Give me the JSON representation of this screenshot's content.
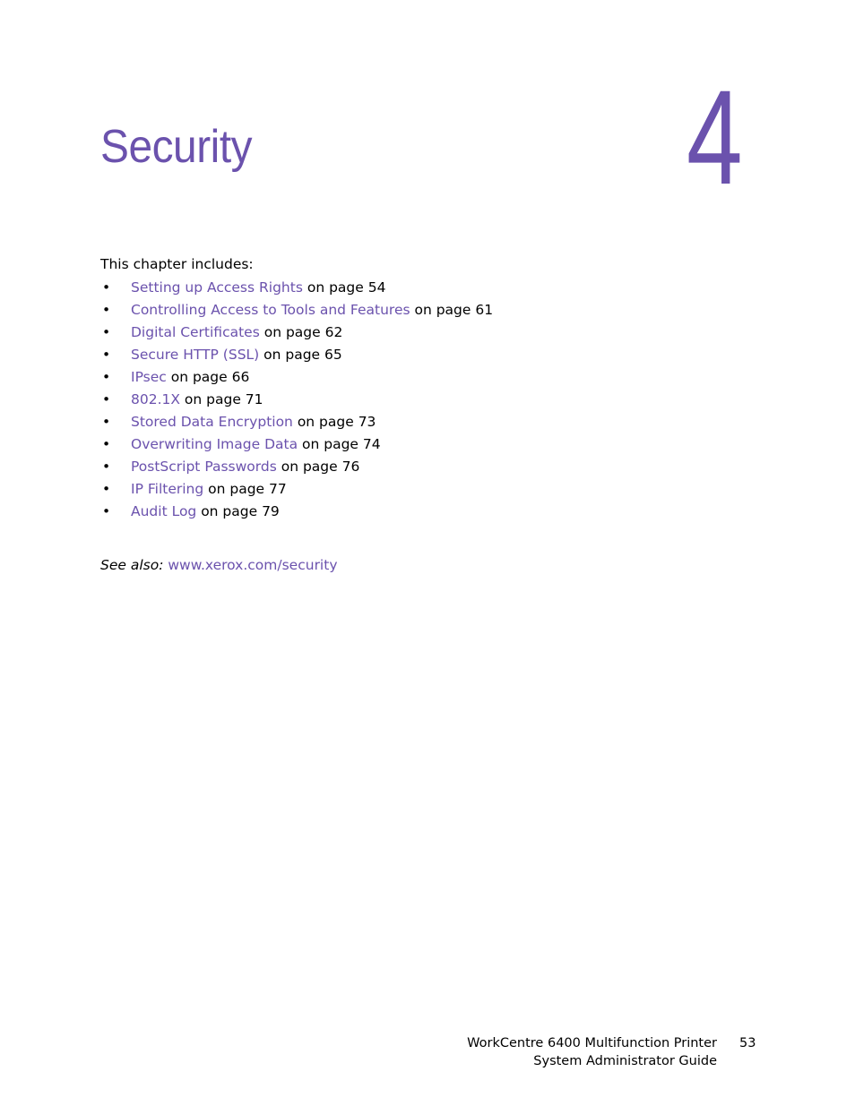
{
  "chapter": {
    "title": "Security",
    "number": "4"
  },
  "intro": "This chapter includes:",
  "toc": [
    {
      "link": "Setting up Access Rights",
      "suffix": " on page 54"
    },
    {
      "link": "Controlling Access to Tools and Features",
      "suffix": " on page 61"
    },
    {
      "link": "Digital Certificates",
      "suffix": " on page 62"
    },
    {
      "link": "Secure HTTP (SSL)",
      "suffix": " on page 65"
    },
    {
      "link": "IPsec",
      "suffix": " on page 66"
    },
    {
      "link": "802.1X",
      "suffix": " on page 71"
    },
    {
      "link": "Stored Data Encryption",
      "suffix": " on page 73"
    },
    {
      "link": "Overwriting Image Data",
      "suffix": " on page 74"
    },
    {
      "link": "PostScript Passwords",
      "suffix": " on page 76"
    },
    {
      "link": "IP Filtering",
      "suffix": " on page 77"
    },
    {
      "link": "Audit Log",
      "suffix": " on page 79"
    }
  ],
  "bullet": "•",
  "see_also": {
    "label": "See also:",
    "link": "www.xerox.com/security"
  },
  "footer": {
    "line1": "WorkCentre 6400 Multifunction Printer",
    "line2": "System Administrator Guide",
    "page": "53"
  },
  "colors": {
    "accent": "#6b52ad"
  }
}
